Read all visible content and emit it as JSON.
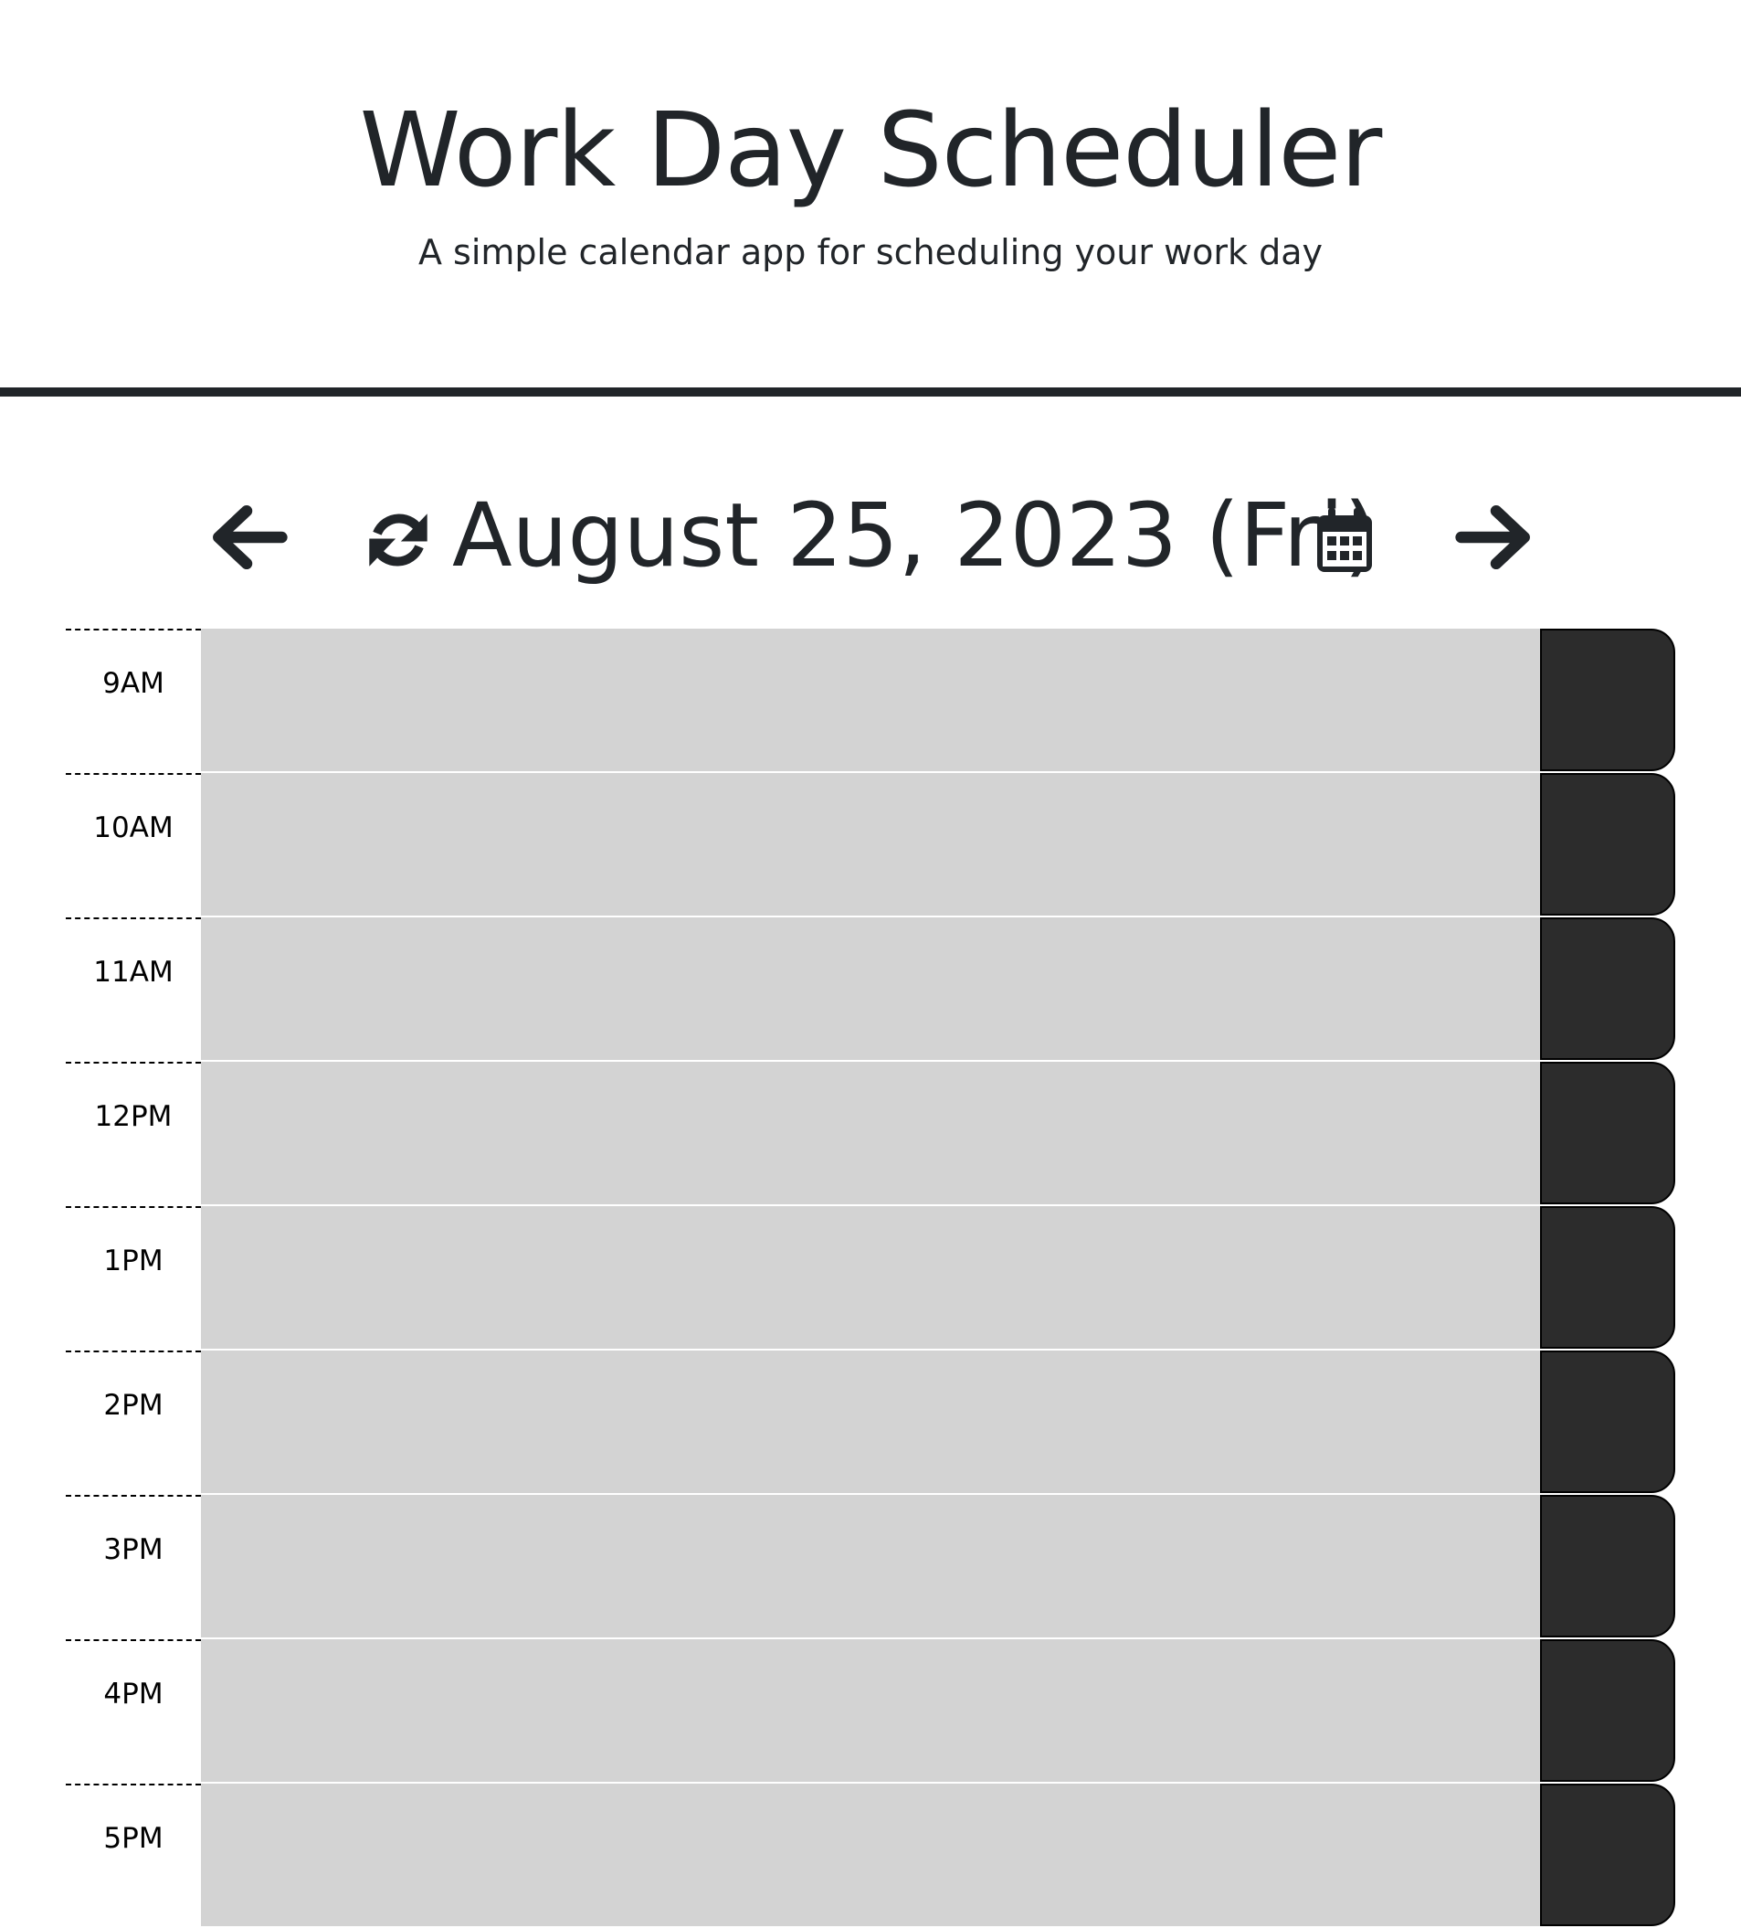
{
  "header": {
    "title": "Work Day Scheduler",
    "subtitle": "A simple calendar app for scheduling your work day"
  },
  "date_nav": {
    "prev_icon": "arrow-left-icon",
    "refresh_icon": "refresh-icon",
    "current_date": "August 25, 2023 (Fri)",
    "calendar_icon": "calendar-icon",
    "next_icon": "arrow-right-icon"
  },
  "schedule": {
    "slots": [
      {
        "hour": "9AM",
        "description": ""
      },
      {
        "hour": "10AM",
        "description": ""
      },
      {
        "hour": "11AM",
        "description": ""
      },
      {
        "hour": "12PM",
        "description": ""
      },
      {
        "hour": "1PM",
        "description": ""
      },
      {
        "hour": "2PM",
        "description": ""
      },
      {
        "hour": "3PM",
        "description": ""
      },
      {
        "hour": "4PM",
        "description": ""
      },
      {
        "hour": "5PM",
        "description": ""
      }
    ]
  },
  "colors": {
    "past_slot": "#d3d3d3",
    "save_button": "#2c2c2c",
    "text": "#212529"
  }
}
